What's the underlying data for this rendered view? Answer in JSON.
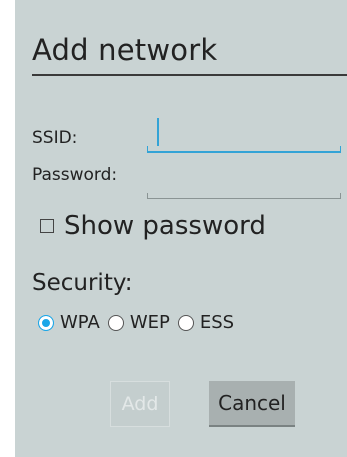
{
  "dialog": {
    "title": "Add network"
  },
  "form": {
    "ssid_label": "SSID:",
    "ssid_value": "",
    "password_label": "Password:",
    "password_value": ""
  },
  "show_password": {
    "label": "Show password",
    "checked": false
  },
  "security": {
    "label": "Security:",
    "options": [
      {
        "label": "WPA",
        "selected": true
      },
      {
        "label": "WEP",
        "selected": false
      },
      {
        "label": "ESS",
        "selected": false
      }
    ]
  },
  "buttons": {
    "add_label": "Add",
    "add_enabled": false,
    "cancel_label": "Cancel"
  },
  "colors": {
    "accent": "#33a3d6",
    "dialog_background": "#c9d3d3"
  }
}
